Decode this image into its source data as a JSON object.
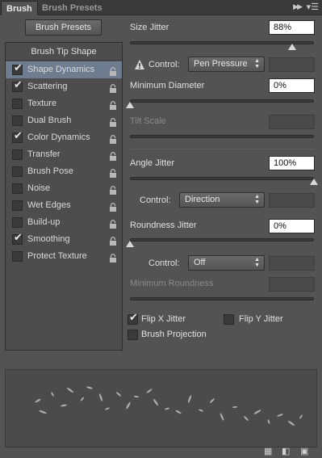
{
  "tabs": [
    {
      "label": "Brush"
    },
    {
      "label": "Brush Presets"
    }
  ],
  "left": {
    "presets_button": "Brush Presets",
    "list_header": "Brush Tip Shape",
    "items": [
      {
        "label": "Shape Dynamics",
        "checked": true,
        "selected": true
      },
      {
        "label": "Scattering",
        "checked": true
      },
      {
        "label": "Texture",
        "checked": false
      },
      {
        "label": "Dual Brush",
        "checked": false
      },
      {
        "label": "Color Dynamics",
        "checked": true
      },
      {
        "label": "Transfer",
        "checked": false
      },
      {
        "label": "Brush Pose",
        "checked": false
      },
      {
        "label": "Noise",
        "checked": false
      },
      {
        "label": "Wet Edges",
        "checked": false
      },
      {
        "label": "Build-up",
        "checked": false
      },
      {
        "label": "Smoothing",
        "checked": true
      },
      {
        "label": "Protect Texture",
        "checked": false
      }
    ]
  },
  "right": {
    "size_jitter": {
      "label": "Size Jitter",
      "value": "88%",
      "level": 0.88
    },
    "size_control": {
      "label": "Control:",
      "value": "Pen Pressure"
    },
    "min_diameter": {
      "label": "Minimum Diameter",
      "value": "0%",
      "level": 0
    },
    "tilt_scale": {
      "label": "Tilt Scale"
    },
    "angle_jitter": {
      "label": "Angle Jitter",
      "value": "100%",
      "level": 1.0
    },
    "angle_control": {
      "label": "Control:",
      "value": "Direction"
    },
    "roundness_jitter": {
      "label": "Roundness Jitter",
      "value": "0%",
      "level": 0
    },
    "roundness_control": {
      "label": "Control:",
      "value": "Off"
    },
    "min_roundness": {
      "label": "Minimum Roundness"
    },
    "flip_x": {
      "label": "Flip X Jitter",
      "checked": true
    },
    "flip_y": {
      "label": "Flip Y Jitter",
      "checked": false
    },
    "brush_projection": {
      "label": "Brush Projection",
      "checked": false
    }
  },
  "icons": {
    "collapse": "double-chevron-right-icon",
    "menu": "panel-menu-icon",
    "lock": "lock-icon",
    "warning": "warning-icon",
    "new_preset": "new-preset-icon",
    "grid": "grid-toggle-icon",
    "new_brush": "create-new-brush-icon"
  }
}
